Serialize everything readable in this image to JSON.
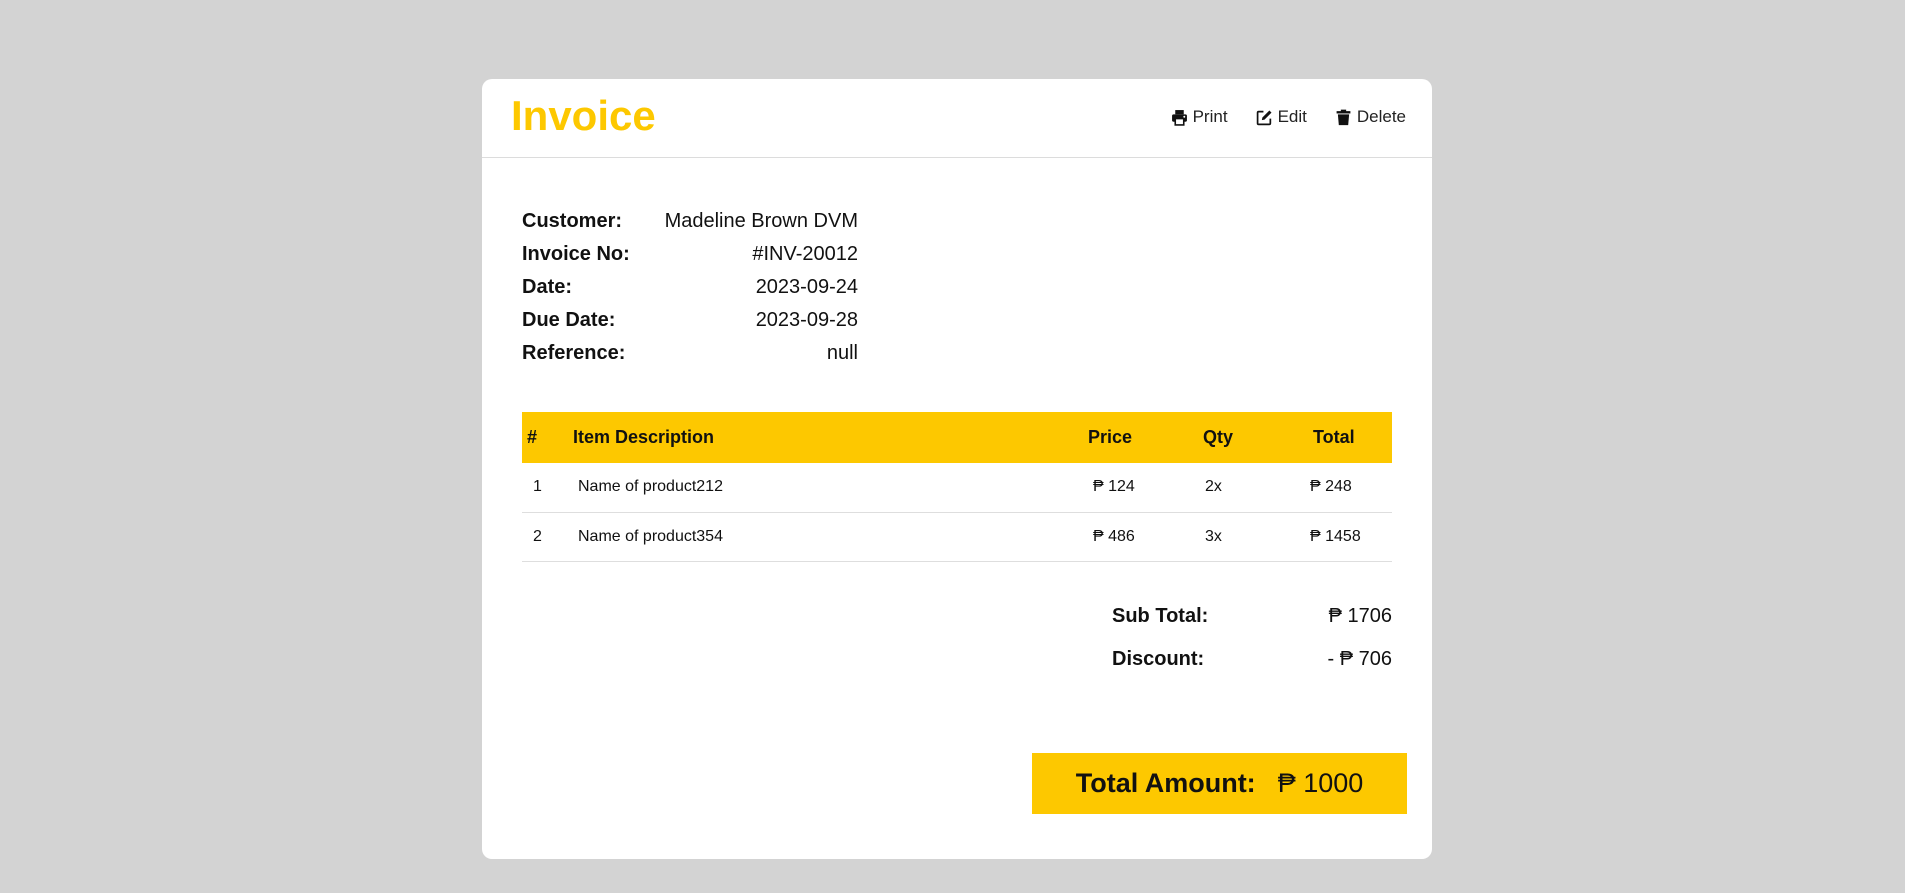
{
  "header": {
    "title": "Invoice",
    "actions": {
      "print": "Print",
      "edit": "Edit",
      "delete": "Delete"
    }
  },
  "info": {
    "customer_label": "Customer:",
    "customer": "Madeline Brown DVM",
    "invoice_no_label": "Invoice No:",
    "invoice_no": "#INV-20012",
    "date_label": "Date:",
    "date": "2023-09-24",
    "due_date_label": "Due Date:",
    "due_date": "2023-09-28",
    "reference_label": "Reference:",
    "reference": "null"
  },
  "table": {
    "headers": [
      "#",
      "Item Description",
      "Price",
      "Qty",
      "Total"
    ],
    "rows": [
      {
        "num": "1",
        "description": "Name of product212",
        "price": "₱ 124",
        "qty": "2x",
        "total": "₱ 248"
      },
      {
        "num": "2",
        "description": "Name of product354",
        "price": "₱ 486",
        "qty": "3x",
        "total": "₱ 1458"
      }
    ]
  },
  "summary": {
    "subtotal_label": "Sub Total:",
    "subtotal": "₱ 1706",
    "discount_label": "Discount:",
    "discount": "- ₱ 706",
    "total_label": "Total Amount:",
    "total": "₱ 1000"
  },
  "colors": {
    "accent": "#fdc800",
    "page_background": "#d3d3d3",
    "card_background": "#ffffff"
  },
  "icons": {
    "print": "printer-icon",
    "edit": "edit-icon",
    "delete": "trash-icon"
  }
}
